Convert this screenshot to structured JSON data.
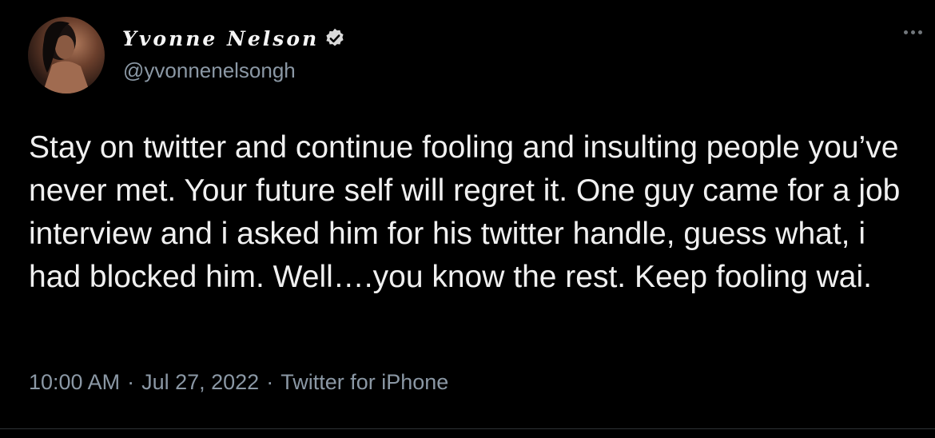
{
  "user": {
    "display_name": "Yvonne Nelson",
    "handle": "@yvonnenelsongh",
    "verified": true,
    "avatar_icon": "profile-photo"
  },
  "tweet": {
    "text": "Stay on twitter and continue fooling and insulting people you’ve never met. Your future self will regret it. One guy came for a job interview and i asked him for his twitter handle, guess what, i had blocked him. Well….you know the rest. Keep fooling wai.",
    "time": "10:00 AM",
    "date": "Jul 27, 2022",
    "source": "Twitter for iPhone",
    "separator": "·"
  },
  "icons": {
    "verified": "verified-badge-icon",
    "more": "more-options-icon"
  },
  "colors": {
    "background": "#000000",
    "text": "#e7e9ea",
    "secondary": "#8b98a5",
    "verified_badge": "#d9d9d9"
  }
}
